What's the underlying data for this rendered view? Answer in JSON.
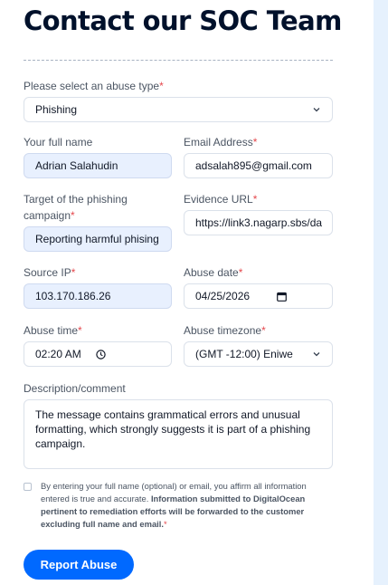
{
  "page_title": "Contact our SOC Team",
  "abuse_type": {
    "label": "Please select an abuse type",
    "value": "Phishing"
  },
  "full_name": {
    "label": "Your full name",
    "value": "Adrian Salahudin"
  },
  "email": {
    "label": "Email Address",
    "value": "adsalah895@gmail.com"
  },
  "target": {
    "label_line1": "Target of the phishing",
    "label_line2": "campaign",
    "value": "Reporting harmful phising"
  },
  "evidence_url": {
    "label": "Evidence URL",
    "value": "https://link3.nagarp.sbs/da"
  },
  "source_ip": {
    "label": "Source IP",
    "value": "103.170.186.26"
  },
  "abuse_date": {
    "label": "Abuse date",
    "value": "04/25/2026"
  },
  "abuse_time": {
    "label": "Abuse time",
    "value": "02:20 AM"
  },
  "abuse_timezone": {
    "label": "Abuse timezone",
    "value": "(GMT -12:00) Eniwe"
  },
  "description": {
    "label": "Description/comment",
    "value": "The message contains grammatical errors and unusual formatting, which strongly suggests it is part of a phishing campaign."
  },
  "consent": {
    "text_plain": "By entering your full name (optional) or email, you affirm all information entered is true and accurate. ",
    "text_bold": "Information submitted to DigitalOcean pertinent to remediation efforts will be forwarded to the customer excluding full name and email.",
    "checked": false
  },
  "submit_label": "Report Abuse",
  "required_marker": "*",
  "colors": {
    "primary": "#0069ff",
    "heading": "#00112b",
    "required": "#e5484d",
    "autofill": "#e8f0fe",
    "side_panel": "#e6f1fd"
  }
}
